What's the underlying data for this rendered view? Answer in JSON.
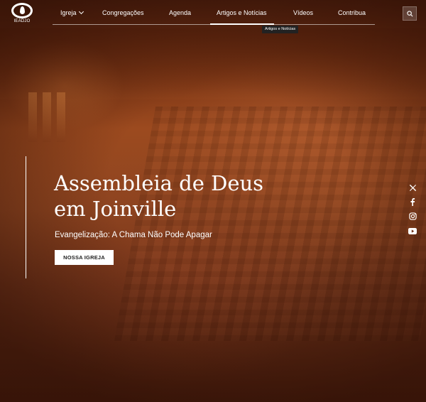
{
  "brand": {
    "logo_text": "IEADJO"
  },
  "nav": {
    "items": [
      {
        "label": "Igreja",
        "has_dropdown": true
      },
      {
        "label": "Congregações"
      },
      {
        "label": "Agenda"
      },
      {
        "label": "Artigos e Notícias",
        "active": true
      },
      {
        "label": "Vídeos"
      },
      {
        "label": "Contribua"
      }
    ],
    "tooltip": "Artigos e Notícias",
    "search_icon": "search-icon"
  },
  "hero": {
    "title_line1": "Assembleia de Deus",
    "title_line2": "em Joinville",
    "subtitle": "Evangelização: A Chama Não Pode Apagar",
    "cta_label": "NOSSA IGREJA"
  },
  "social": [
    "x-icon",
    "facebook-icon",
    "instagram-icon",
    "youtube-icon"
  ],
  "colors": {
    "accent_overlay": "#9c4a1f",
    "text": "#ffffff",
    "button_bg": "#ffffff",
    "button_text": "#222222"
  }
}
